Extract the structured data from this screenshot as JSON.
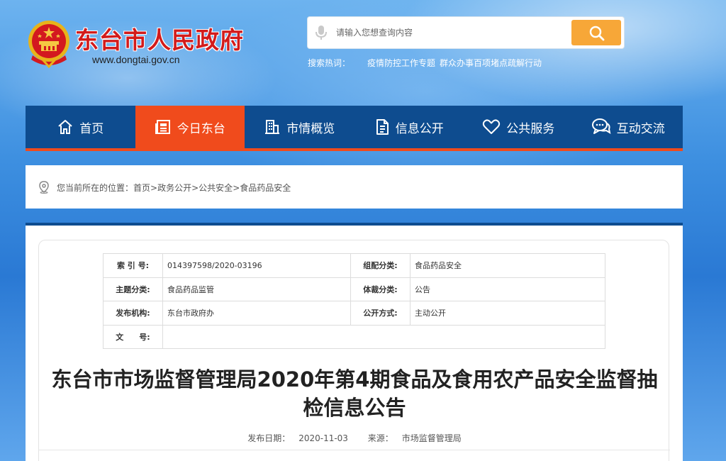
{
  "header": {
    "site_title": "东台市人民政府",
    "site_url": "www.dongtai.gov.cn",
    "emblem_icon": "national-emblem-icon",
    "search": {
      "placeholder": "请输入您想查询内容",
      "button_icon": "search-icon"
    },
    "hot_words": {
      "label": "搜索热词：",
      "items": [
        "疫情防控工作专题",
        "群众办事百项堵点疏解行动"
      ]
    }
  },
  "nav": {
    "items": [
      {
        "label": "首页",
        "icon": "home-icon",
        "active": false
      },
      {
        "label": "今日东台",
        "icon": "newspaper-icon",
        "active": true
      },
      {
        "label": "市情概览",
        "icon": "building-icon",
        "active": false
      },
      {
        "label": "信息公开",
        "icon": "document-icon",
        "active": false
      },
      {
        "label": "公共服务",
        "icon": "heart-icon",
        "active": false
      },
      {
        "label": "互动交流",
        "icon": "chat-icon",
        "active": false
      }
    ]
  },
  "breadcrumb": {
    "prefix": "您当前所在的位置：",
    "items": [
      "首页",
      "政务公开",
      "公共安全",
      "食品药品安全"
    ],
    "separator": ">"
  },
  "meta": {
    "index_label": "索 引 号:",
    "index_value": "014397598/2020-03196",
    "category_label": "组配分类:",
    "category_value": "食品药品安全",
    "topic_label": "主题分类:",
    "topic_value": "食品药品监管",
    "genre_label": "体裁分类:",
    "genre_value": "公告",
    "publisher_label": "发布机构:",
    "publisher_value": "东台市政府办",
    "disclosure_label": "公开方式:",
    "disclosure_value": "主动公开",
    "doc_no_label": "文　　号:",
    "doc_no_value": ""
  },
  "article": {
    "title": "东台市市场监督管理局2020年第4期食品及食用农产品安全监督抽检信息公告",
    "date_label": "发布日期：",
    "date": "2020-11-03",
    "source_label": "来源：",
    "source": "市场监督管理局"
  },
  "colors": {
    "nav_bg": "#0e4c8f",
    "accent": "#f04b1c",
    "search_button": "#f7a738",
    "title_red": "#d21b1b"
  }
}
